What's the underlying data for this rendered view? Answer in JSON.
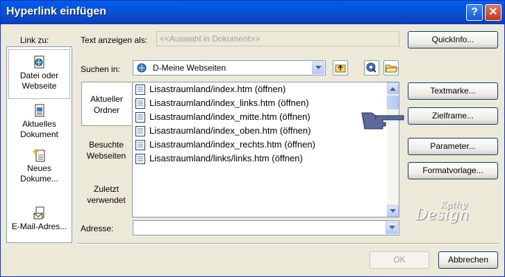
{
  "window": {
    "title": "Hyperlink einfügen",
    "help_glyph": "?",
    "close_glyph": "✕"
  },
  "link_to": {
    "label": "Link zu:",
    "items": [
      {
        "label": "Datei oder Webseite",
        "icon": "globe-document-icon",
        "active": true
      },
      {
        "label": "Aktuelles Dokument",
        "icon": "document-icon",
        "active": false
      },
      {
        "label": "Neues Dokume...",
        "icon": "new-document-icon",
        "active": false
      },
      {
        "label": "E-Mail-Adres...",
        "icon": "email-icon",
        "active": false
      }
    ]
  },
  "display_text": {
    "label": "Text anzeigen als:",
    "value": "<<Auswahl in Dokument>>"
  },
  "look_in": {
    "label": "Suchen in:",
    "value": "D-Meine Webseiten"
  },
  "tabs": [
    {
      "label": "Aktueller Ordner",
      "active": true
    },
    {
      "label": "Besuchte Webseiten",
      "active": false
    },
    {
      "label": "Zuletzt verwendet",
      "active": false
    }
  ],
  "files": [
    "Lisastraumland/index.htm (öffnen)",
    "Lisastraumland/index_links.htm (öffnen)",
    "Lisastraumland/index_mitte.htm (öffnen)",
    "Lisastraumland/index_oben.htm (öffnen)",
    "Lisastraumland/index_rechts.htm (öffnen)",
    "Lisastraumland/links/links.htm (öffnen)"
  ],
  "address": {
    "label": "Adresse:",
    "value": ""
  },
  "buttons": {
    "quickinfo": "QuickInfo...",
    "bookmark": "Textmarke...",
    "target_frame": "Zielframe...",
    "parameters": "Parameter...",
    "style": "Formatvorlage...",
    "ok": "OK",
    "cancel": "Abbrechen"
  },
  "watermark": {
    "line1": "Kathy",
    "line2": "Design"
  },
  "colors": {
    "title_bar": "#0058e6",
    "dialog_bg": "#ece9d8",
    "field_border": "#7f9db9"
  }
}
